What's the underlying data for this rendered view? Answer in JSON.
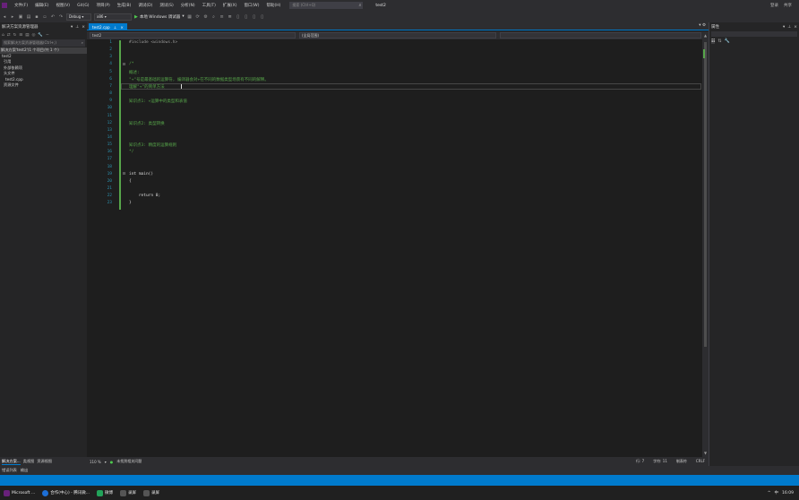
{
  "menubar": {
    "items": [
      "文件(F)",
      "编辑(E)",
      "视图(V)",
      "Git(G)",
      "项目(P)",
      "生成(B)",
      "调试(D)",
      "测试(S)",
      "分析(N)",
      "工具(T)",
      "扩展(X)",
      "窗口(W)",
      "帮助(H)"
    ],
    "search_placeholder": "搜索 (Ctrl+Q)",
    "project_name": "test2",
    "right_items": [
      "登录",
      "共享"
    ]
  },
  "toolbar": {
    "config": "Debug",
    "platform": "x86",
    "run_label": "本地 Windows 调试器"
  },
  "solution_explorer": {
    "title": "解决方案资源管理器",
    "search_placeholder": "搜索解决方案资源管理器(Ctrl+;)",
    "items": [
      "解决方案'test2'(1 个项目/共 1 个)",
      "test2",
      "引用",
      "外部依赖项",
      "头文件",
      "test2.cpp",
      "资源文件"
    ]
  },
  "left_tabs": [
    "解决方案...",
    "类视图",
    "资源视图"
  ],
  "editor": {
    "tab_label": "test2.cpp",
    "nav_project": "test2",
    "nav_scope": "(全局范围)",
    "lines": [
      {
        "n": "1",
        "text": "#include <windows.h>",
        "cls": "c-pre"
      },
      {
        "n": "2",
        "text": "",
        "cls": "c-txt"
      },
      {
        "n": "3",
        "text": "",
        "cls": "c-txt"
      },
      {
        "n": "4",
        "text": "/*",
        "cls": "c-comment"
      },
      {
        "n": "5",
        "text": "概述:",
        "cls": "c-comment"
      },
      {
        "n": "6",
        "text": "\"+\"号是最基础的运算符, 编译器会对+在不同的数据类型场景有不同的解释。",
        "cls": "c-comment"
      },
      {
        "n": "7",
        "text": "理解\"+\"的简单方法",
        "cls": "c-comment"
      },
      {
        "n": "8",
        "text": "",
        "cls": "c-txt"
      },
      {
        "n": "9",
        "text": "知识点1: +运算中的类型和表值",
        "cls": "c-comment"
      },
      {
        "n": "10",
        "text": "",
        "cls": "c-txt"
      },
      {
        "n": "11",
        "text": "",
        "cls": "c-txt"
      },
      {
        "n": "12",
        "text": "知识点2: 类型转换",
        "cls": "c-comment"
      },
      {
        "n": "13",
        "text": "",
        "cls": "c-txt"
      },
      {
        "n": "14",
        "text": "",
        "cls": "c-txt"
      },
      {
        "n": "15",
        "text": "知识点3: 精度的运算规则",
        "cls": "c-comment"
      },
      {
        "n": "16",
        "text": "*/",
        "cls": "c-comment"
      },
      {
        "n": "17",
        "text": "",
        "cls": "c-txt"
      },
      {
        "n": "18",
        "text": "",
        "cls": "c-txt"
      },
      {
        "n": "19",
        "text": "int main()",
        "cls": "c-txt"
      },
      {
        "n": "20",
        "text": "{",
        "cls": "c-txt"
      },
      {
        "n": "21",
        "text": "",
        "cls": "c-txt"
      },
      {
        "n": "22",
        "text": "    return 0;",
        "cls": "c-txt"
      },
      {
        "n": "23",
        "text": "}",
        "cls": "c-txt"
      }
    ]
  },
  "right_panel": {
    "title": "属性"
  },
  "edit_status": {
    "zoom": "110 %",
    "issues": "未找到相关问题",
    "row": "行: 7",
    "col": "字符: 11",
    "mode": "制表符",
    "eol": "CRLF"
  },
  "output_tabs": [
    "错误列表",
    "输出"
  ],
  "taskbar": {
    "items": [
      {
        "label": "Microsoft ...",
        "color": "#68217a"
      },
      {
        "label": "合作(中心) - 腾讯微...",
        "color": "#1d6fd6"
      },
      {
        "label": "微博",
        "color": "#22a35a"
      },
      {
        "label": "录屏",
        "color": "#555555"
      },
      {
        "label": "录屏",
        "color": "#555555"
      }
    ],
    "tray": [
      "^",
      "中",
      "16:09"
    ]
  }
}
